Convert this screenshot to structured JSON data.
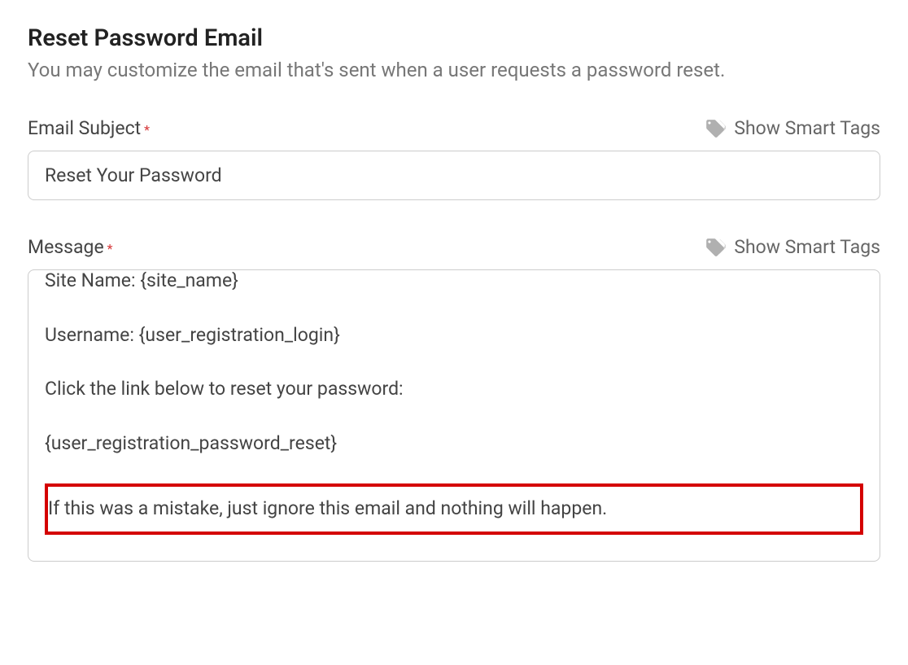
{
  "section": {
    "title": "Reset Password Email",
    "subtitle": "You may customize the email that's sent when a user requests a password reset."
  },
  "fields": {
    "subject": {
      "label": "Email Subject",
      "required_mark": "*",
      "smart_tags_label": "Show Smart Tags",
      "value": "Reset Your Password"
    },
    "message": {
      "label": "Message",
      "required_mark": "*",
      "smart_tags_label": "Show Smart Tags",
      "lines": {
        "l1": "Site Name: {site_name}",
        "l2": "Username: {user_registration_login}",
        "l3": "Click the link below to reset your password:",
        "l4": "{user_registration_password_reset}",
        "l5": "If this was a mistake, just ignore this email and nothing will happen."
      }
    }
  }
}
